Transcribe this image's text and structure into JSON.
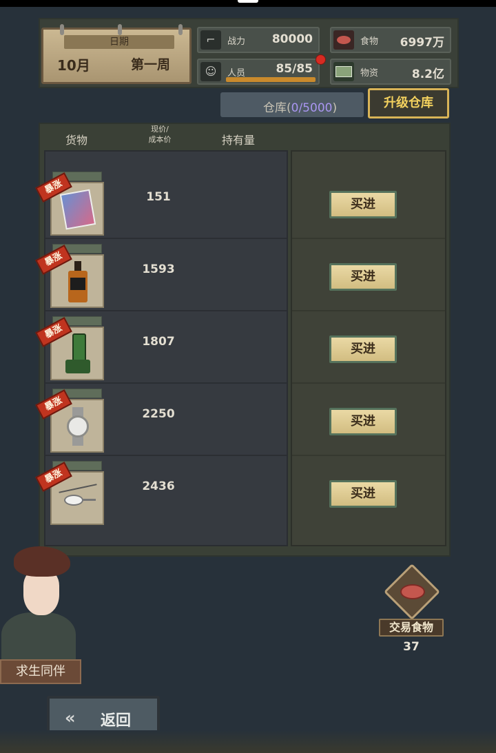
{
  "header": {
    "date_label": "日期",
    "month": "10月",
    "week": "第一周",
    "stats": {
      "power": {
        "label": "战力",
        "value": "80000",
        "icon": "gun-icon"
      },
      "food": {
        "label": "食物",
        "value": "6997万",
        "icon": "meat-icon"
      },
      "staff": {
        "label": "人员",
        "value": "85/85",
        "icon": "person-icon",
        "fill_fraction": 1.0
      },
      "supplies": {
        "label": "物资",
        "value": "8.2亿",
        "icon": "cash-icon"
      }
    },
    "notification_dot_color": "#d72b22"
  },
  "warehouse": {
    "label": "仓库",
    "open_paren": "(",
    "count": "0/5000",
    "close_paren": ")",
    "count_color": "#a996f1"
  },
  "upgrade_button": "升级仓库",
  "columns": {
    "goods": "货物",
    "price_line1": "现价/",
    "price_line2": "成本价",
    "holding": "持有量"
  },
  "items": [
    {
      "tag": "暴涨",
      "price": "151",
      "icon": "comic-book-icon",
      "buy": "买进"
    },
    {
      "tag": "暴涨",
      "price": "1593",
      "icon": "whiskey-bottle-icon",
      "buy": "买进"
    },
    {
      "tag": "暴涨",
      "price": "1807",
      "icon": "walkie-talkie-icon",
      "buy": "买进"
    },
    {
      "tag": "暴涨",
      "price": "2250",
      "icon": "wristwatch-icon",
      "buy": "买进"
    },
    {
      "tag": "暴涨",
      "price": "2436",
      "icon": "helicopter-icon",
      "buy": "买进"
    }
  ],
  "trade_food": {
    "label": "交易食物",
    "count": "37",
    "icon": "meat-icon"
  },
  "companion": {
    "label": "求生同伴"
  },
  "back_button": {
    "label": "返回",
    "icon": "double-arrow-left-icon"
  }
}
